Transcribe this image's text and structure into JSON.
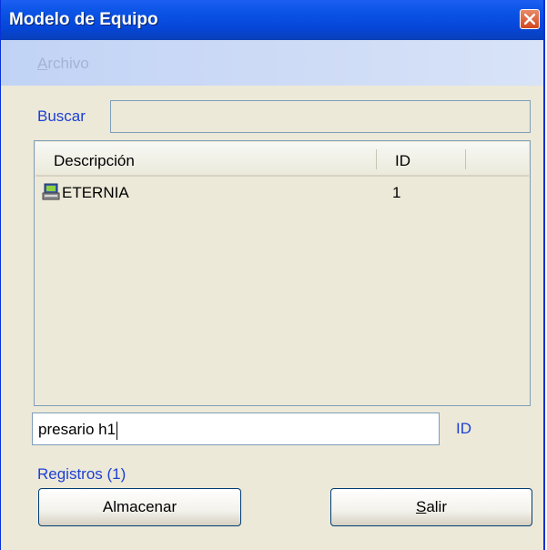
{
  "window": {
    "title": "Modelo de Equipo"
  },
  "menu": {
    "items": [
      {
        "label": "Archivo",
        "accel": "A",
        "rest": "rchivo"
      }
    ]
  },
  "search": {
    "label": "Buscar",
    "value": ""
  },
  "list": {
    "columns": [
      "Descripción",
      "ID"
    ],
    "rows": [
      {
        "descripcion": "ETERNIA",
        "id": "1",
        "icon": "computer-icon"
      }
    ]
  },
  "entry": {
    "value": "presario h1",
    "id_label": "ID"
  },
  "status": {
    "registros": "Registros (1)"
  },
  "buttons": {
    "save": "Almacenar",
    "exit": "Salir",
    "exit_accel": "S",
    "exit_rest": "alir"
  },
  "colors": {
    "title_bar": "#0a54e6",
    "label_blue": "#1c3fd4",
    "close_red": "#d2471d"
  }
}
